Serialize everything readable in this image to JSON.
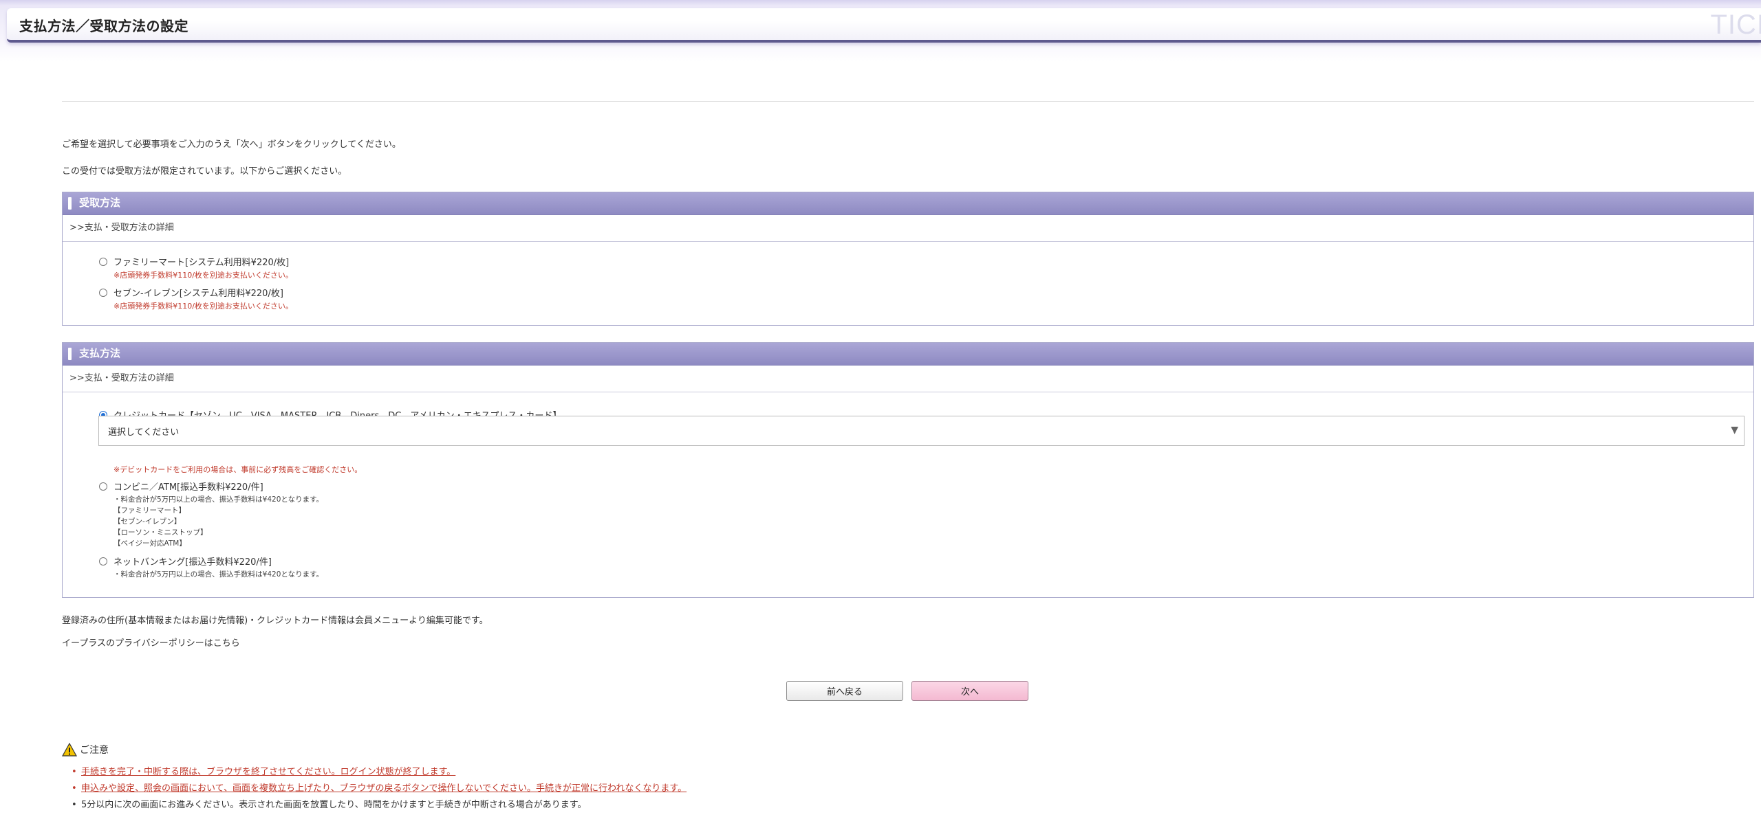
{
  "header": {
    "title": "支払方法／受取方法の設定",
    "brand_mark": "TICI"
  },
  "intro": {
    "line1": "ご希望を選択して必要事項をご入力のうえ「次へ」ボタンをクリックしてください。",
    "line2": "この受付では受取方法が限定されています。以下からご選択ください。"
  },
  "receive": {
    "title": "受取方法",
    "detail_link": ">>支払・受取方法の詳細",
    "options": [
      {
        "label": "ファミリーマート[システム利用料¥220/枚]",
        "note": "※店頭発券手数料¥110/枚を別途お支払いください。",
        "selected": false
      },
      {
        "label": "セブン-イレブン[システム利用料¥220/枚]",
        "note": "※店頭発券手数料¥110/枚を別途お支払いください。",
        "selected": false
      }
    ]
  },
  "payment": {
    "title": "支払方法",
    "detail_link": ">>支払・受取方法の詳細",
    "credit": {
      "label": "クレジットカード【セゾン、UC、VISA、MASTER、JCB、Diners、DC、アメリカン・エキスプレス・カード】",
      "selected": true,
      "select_value": "選択してください",
      "note": "※デビットカードをご利用の場合は、事前に必ず残高をご確認ください。"
    },
    "convenience": {
      "label": "コンビニ／ATM[振込手数料¥220/件]",
      "selected": false,
      "notes": [
        "・料金合計が5万円以上の場合、振込手数料は¥420となります。",
        "【ファミリーマート】",
        "【セブン-イレブン】",
        "【ローソン・ミニストップ】",
        "【ペイジー対応ATM】"
      ]
    },
    "netbank": {
      "label": "ネットバンキング[振込手数料¥220/件]",
      "selected": false,
      "note": "・料金合計が5万円以上の場合、振込手数料は¥420となります。"
    }
  },
  "info": {
    "address_note": "登録済みの住所(基本情報またはお届け先情報)・クレジットカード情報は会員メニューより編集可能です。",
    "privacy_link": "イープラスのプライバシーポリシーはこちら"
  },
  "buttons": {
    "back": "前へ戻る",
    "next": "次へ"
  },
  "caution": {
    "title": "ご注意",
    "bullet": "•",
    "items": [
      "手続きを完了・中断する際は、ブラウザを終了させてください。ログイン状態が終了します。",
      "申込みや設定、照会の画面において、画面を複数立ち上げたり、ブラウザの戻るボタンで操作しないでください。手続きが正常に行われなくなります。",
      "5分以内に次の画面にお進みください。表示された画面を放置したり、時間をかけますと手続きが中断される場合があります。"
    ]
  },
  "colors": {
    "section_header": "#9a96cc",
    "note_red": "#c0392b",
    "next_button": "#f6c4d9",
    "radio_selected": "#1f6fd6"
  }
}
